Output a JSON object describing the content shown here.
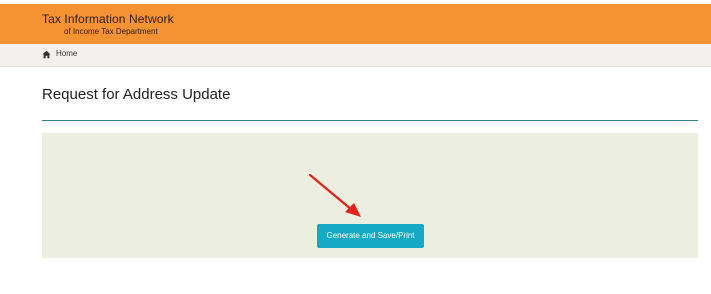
{
  "header": {
    "title": "Tax Information Network",
    "subtitle": "of Income Tax Department",
    "background_color": "#f59231"
  },
  "breadcrumb": {
    "icon": "home-icon",
    "home_label": "Home"
  },
  "page": {
    "title": "Request for Address Update",
    "accent_color": "#2f7f97"
  },
  "panel": {
    "background_color": "#eceedf",
    "annotation": "red-arrow-pointing-to-button"
  },
  "actions": {
    "generate_label": "Generate and Save/Print",
    "button_color": "#14a9c4"
  }
}
